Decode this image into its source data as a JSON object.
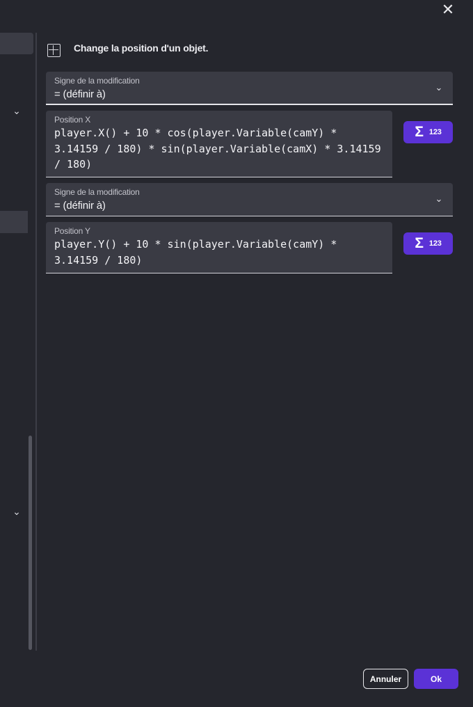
{
  "dialog": {
    "close_icon": "close-icon",
    "instruction": {
      "icon": "position-grid-icon",
      "text": "Change la position d'un objet."
    },
    "parameters": [
      {
        "label": "Signe de la modification",
        "value": "= (définir à)"
      },
      {
        "label": "Position X",
        "value": "player.X() + 10 * cos(player.Variable(camY) * 3.14159 / 180) * sin(player.Variable(camX) * 3.14159 / 180)",
        "expression_button": {
          "icon": "sigma-icon",
          "badge": "123"
        }
      },
      {
        "label": "Signe de la modification",
        "value": "= (définir à)"
      },
      {
        "label": "Position Y",
        "value": "player.Y() + 10 * sin(player.Variable(camY) * 3.14159 / 180)",
        "expression_button": {
          "icon": "sigma-icon",
          "badge": "123"
        }
      }
    ],
    "footer": {
      "cancel_label": "Annuler",
      "ok_label": "Ok"
    }
  },
  "colors": {
    "background": "#25262d",
    "field_background": "#3a3b44",
    "accent": "#5b32d6"
  }
}
